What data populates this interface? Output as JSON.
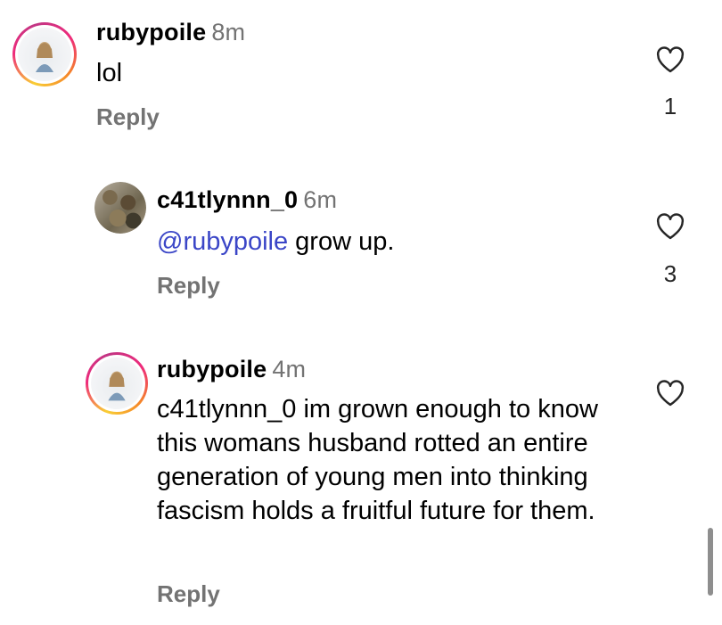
{
  "comments": [
    {
      "username": "rubypoile",
      "time": "8m",
      "text_parts": [
        "lol"
      ],
      "reply_label": "Reply",
      "like_count": "1"
    },
    {
      "username": "c41tlynnn_0",
      "time": "6m",
      "mention": "@rubypoile",
      "text": " grow up.",
      "reply_label": "Reply",
      "like_count": "3"
    },
    {
      "username": "rubypoile",
      "time": "4m",
      "text": "c41tlynnn_0 im grown enough to know this womans husband rotted an entire generation of young men into thinking fascism holds a fruitful future for them.",
      "reply_label": "Reply",
      "like_count": ""
    }
  ],
  "icons": {
    "like": "heart-outline-icon"
  },
  "colors": {
    "mention": "#3b46c7",
    "secondary_text": "#737373",
    "story_ring": [
      "#f9ce34",
      "#ee2a7b",
      "#c13584"
    ]
  }
}
